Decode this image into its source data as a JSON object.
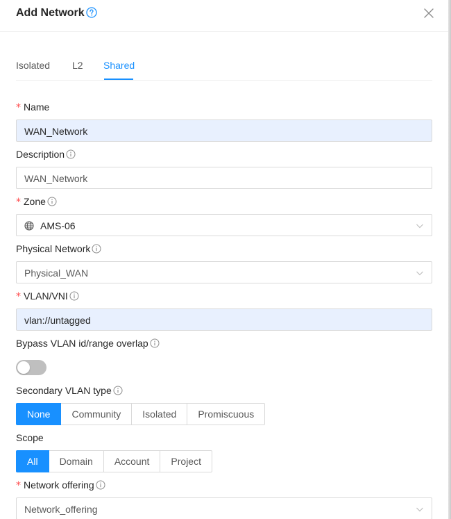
{
  "dialog": {
    "title": "Add Network"
  },
  "tabs": [
    {
      "label": "Isolated"
    },
    {
      "label": "L2"
    },
    {
      "label": "Shared"
    }
  ],
  "active_tab": "Shared",
  "form": {
    "name": {
      "label": "Name",
      "required": true,
      "value": "WAN_Network"
    },
    "description": {
      "label": "Description",
      "value": "WAN_Network"
    },
    "zone": {
      "label": "Zone",
      "required": true,
      "value": "AMS-06"
    },
    "physical_network": {
      "label": "Physical Network",
      "value": "Physical_WAN"
    },
    "vlan": {
      "label": "VLAN/VNI",
      "required": true,
      "value": "vlan://untagged"
    },
    "bypass_vlan": {
      "label": "Bypass VLAN id/range overlap",
      "enabled": false
    },
    "secondary_vlan_type": {
      "label": "Secondary VLAN type",
      "options": [
        "None",
        "Community",
        "Isolated",
        "Promiscuous"
      ],
      "selected": "None"
    },
    "scope": {
      "label": "Scope",
      "options": [
        "All",
        "Domain",
        "Account",
        "Project"
      ],
      "selected": "All"
    },
    "network_offering": {
      "label": "Network offering",
      "required": true,
      "value": "Network_offering"
    }
  },
  "colors": {
    "accent": "#1890ff",
    "required": "#ff4d4f",
    "autofill_bg": "#e8f0fe",
    "border": "#d9d9d9"
  },
  "icons": [
    "help-icon",
    "close-icon",
    "info-icon",
    "globe-icon",
    "chevron-down-icon"
  ]
}
